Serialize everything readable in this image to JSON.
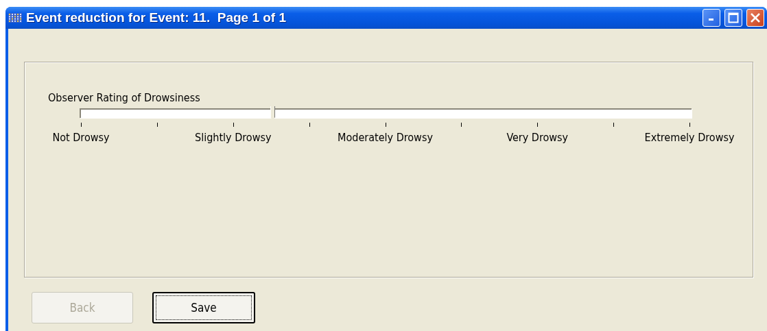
{
  "window": {
    "title": "Event reduction for Event: 11.  Page 1 of 1"
  },
  "slider": {
    "label": "Observer Rating of Drowsiness",
    "level": 0.314,
    "scale": [
      "Not Drowsy",
      "Slightly Drowsy",
      "Moderately Drowsy",
      "Very Drowsy",
      "Extremely Drowsy"
    ]
  },
  "buttons": [
    {
      "label": "Back",
      "disabled": true,
      "focused": false
    },
    {
      "label": "Save",
      "disabled": false,
      "focused": true
    }
  ]
}
